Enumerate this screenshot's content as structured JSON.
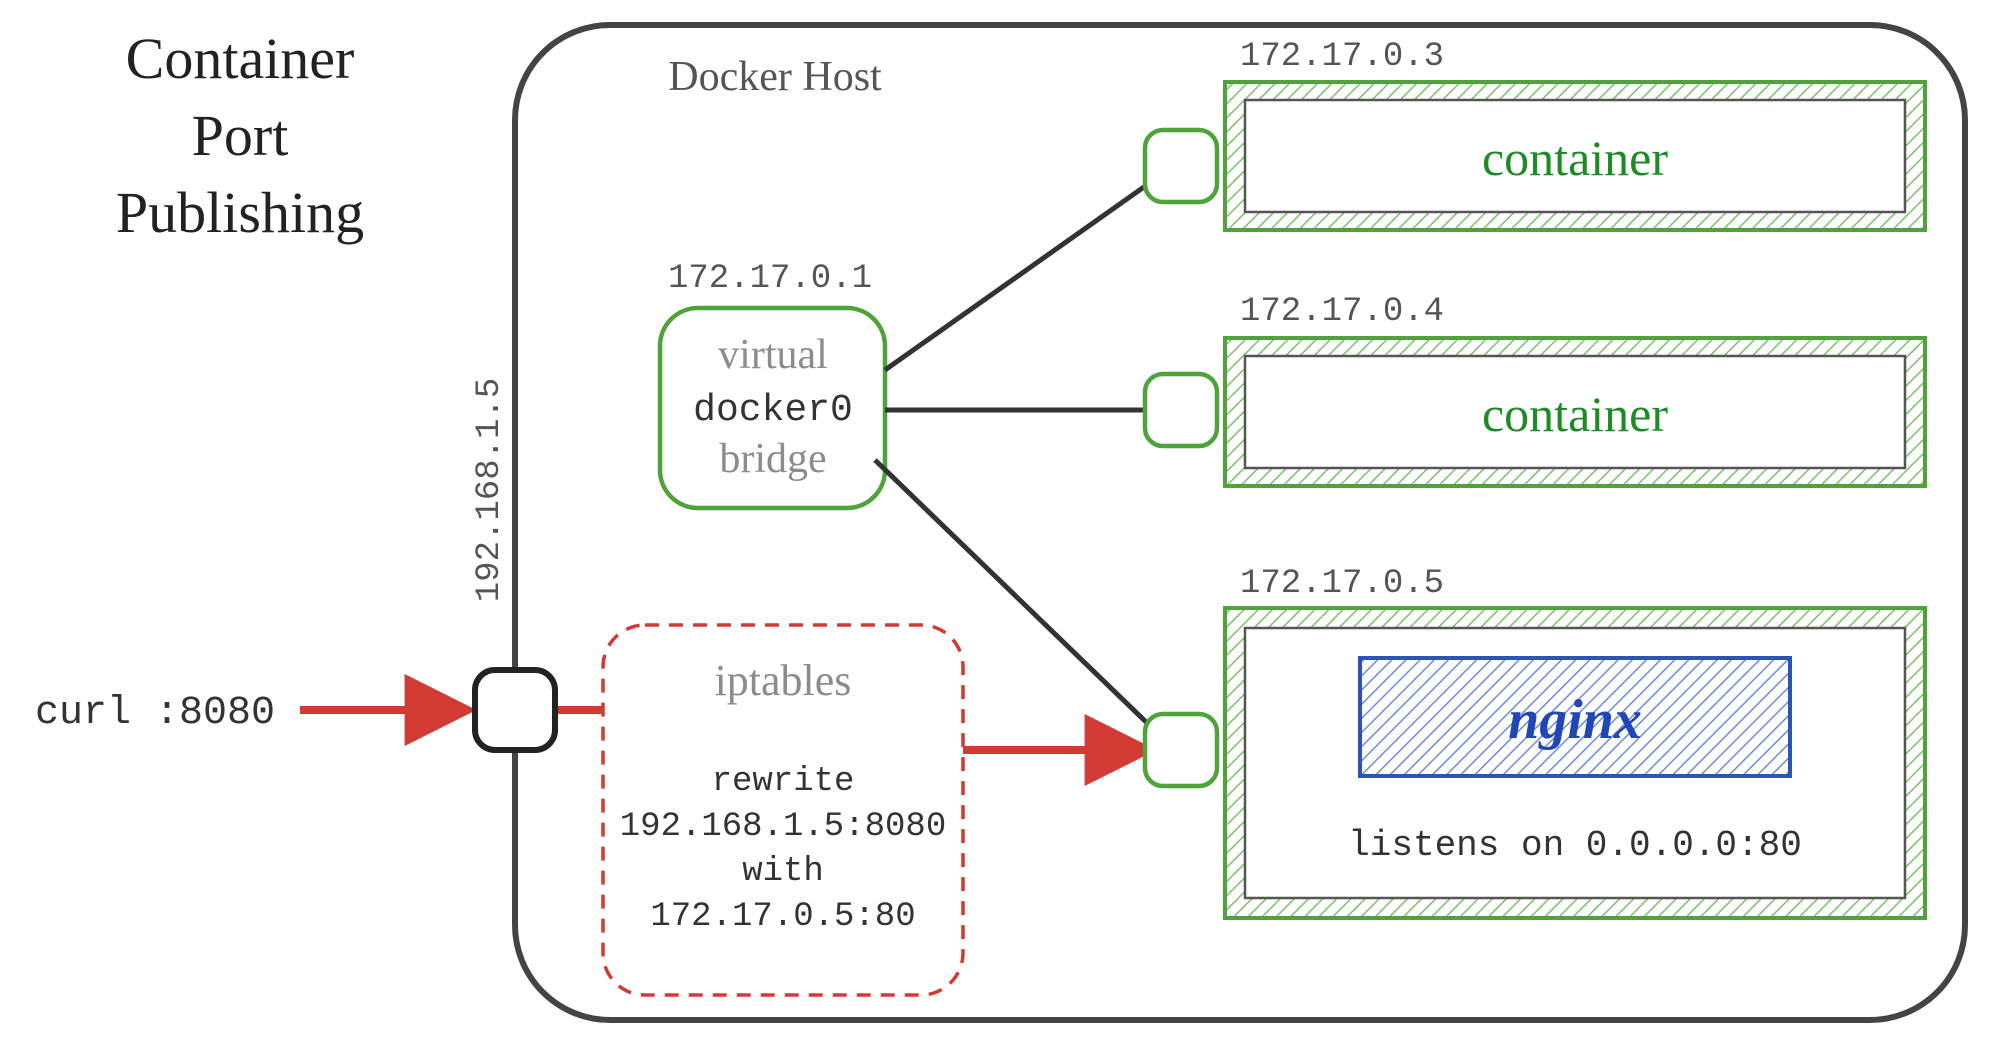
{
  "diagram": {
    "title_line1": "Container",
    "title_line2": "Port",
    "title_line3": "Publishing",
    "curl_label": "curl :8080",
    "host_ip": "192.168.1.5",
    "host_box_label": "Docker Host",
    "bridge_ip": "172.17.0.1",
    "bridge_line1": "virtual",
    "bridge_line2": "docker0",
    "bridge_line3": "bridge",
    "iptables_title": "iptables",
    "iptables_line1": "rewrite",
    "iptables_line2": "192.168.1.5:8080",
    "iptables_line3": "with",
    "iptables_line4": "172.17.0.5:80",
    "container1_ip": "172.17.0.3",
    "container1_label": "container",
    "container2_ip": "172.17.0.4",
    "container2_label": "container",
    "container3_ip": "172.17.0.5",
    "nginx_label": "nginx",
    "nginx_listen": "listens on 0.0.0.0:80"
  }
}
